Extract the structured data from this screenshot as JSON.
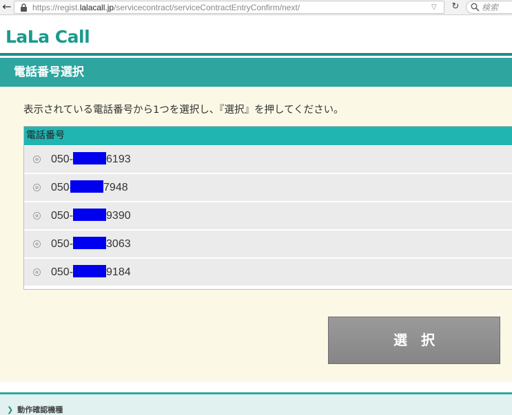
{
  "browser": {
    "url_prefix": "https://regist.",
    "url_domain": "lalacall.jp",
    "url_path": "/servicecontract/serviceContractEntryConfirm/next/",
    "search_placeholder": "検索"
  },
  "header": {
    "logo_text": "LaLa Call",
    "brand_color": "#1a9a8e"
  },
  "page": {
    "title": "電話番号選択",
    "instruction": "表示されている電話番号から1つを選択し、『選択』を押してください。"
  },
  "table": {
    "header": "電話番号",
    "rows": [
      {
        "prefix": "050-",
        "suffix": "6193"
      },
      {
        "prefix": "050-",
        "suffix": "7948"
      },
      {
        "prefix": "050-",
        "suffix": "9390"
      },
      {
        "prefix": "050-",
        "suffix": "3063"
      },
      {
        "prefix": "050-",
        "suffix": "9184"
      }
    ]
  },
  "actions": {
    "select_label": "選択"
  },
  "footer": {
    "link_label": "動作確認機種"
  },
  "colors": {
    "accent": "#2ea59f",
    "table_header": "#21b5b2",
    "content_bg": "#fbf8e6",
    "redaction": "#0000f0"
  }
}
